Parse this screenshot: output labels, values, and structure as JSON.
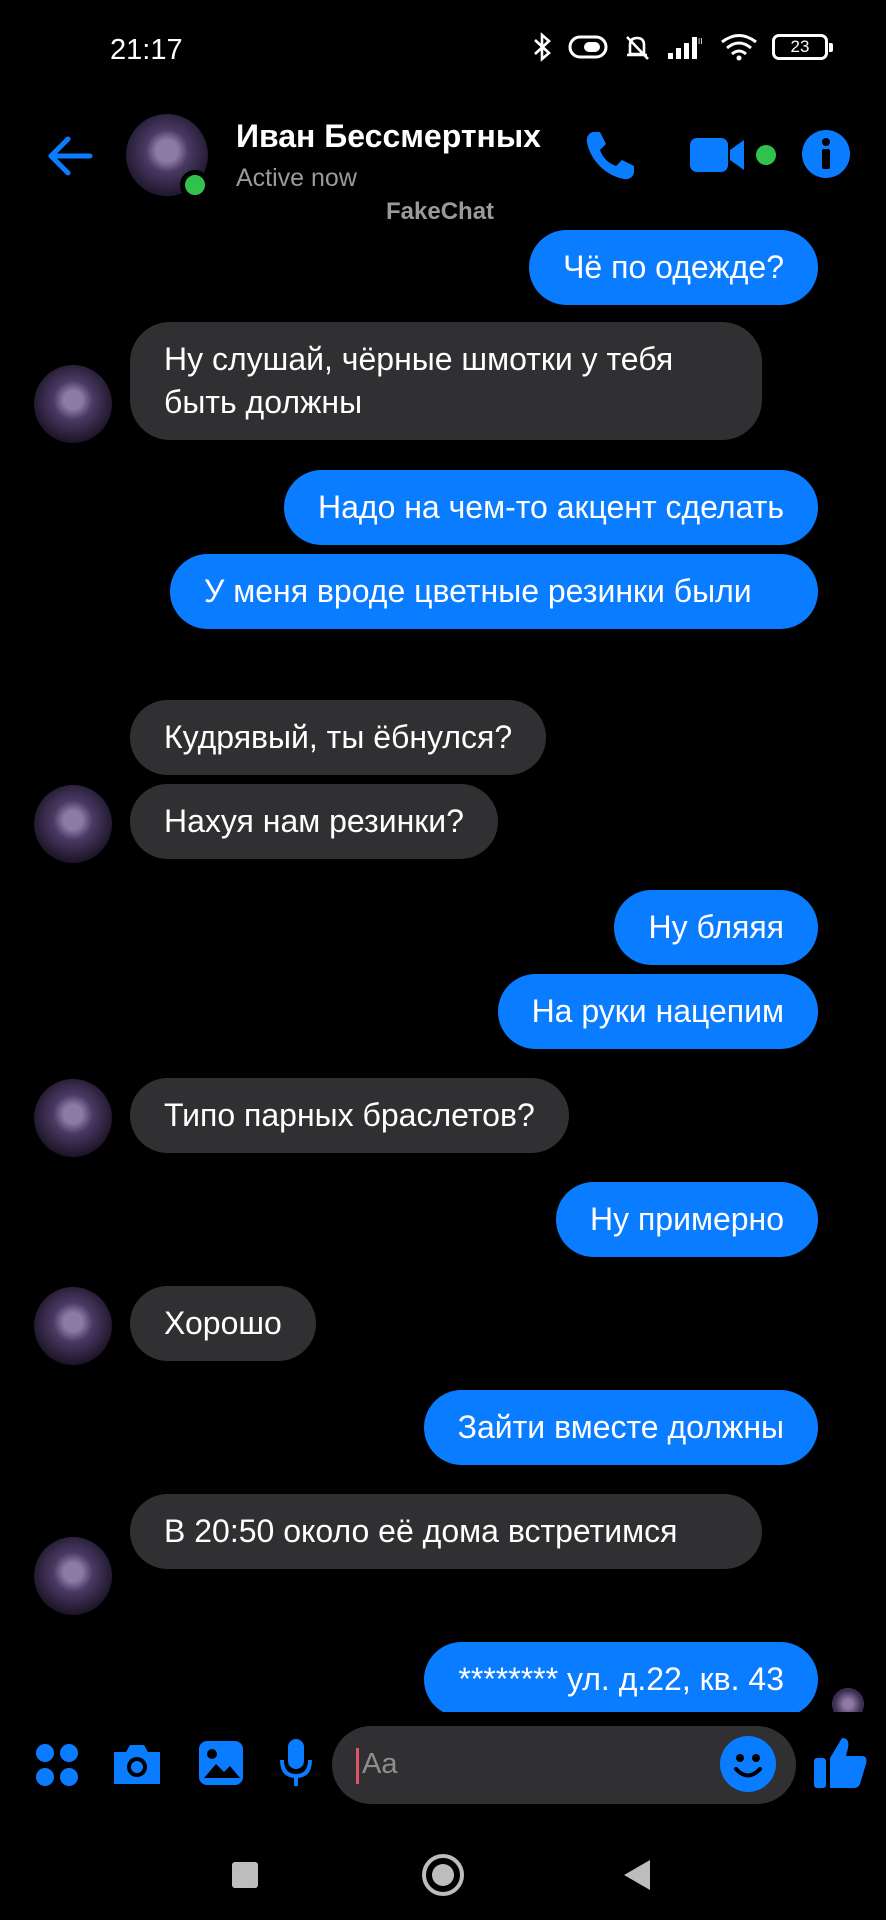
{
  "status_bar": {
    "time": "21:17",
    "battery": "23"
  },
  "header": {
    "name": "Иван Бессмертных",
    "status": "Active now",
    "watermark": "FakeChat"
  },
  "messages": [
    {
      "side": "out",
      "text": "Чё по одежде?"
    },
    {
      "side": "in",
      "text": "Ну слушай, чёрные шмотки у тебя быть должны"
    },
    {
      "side": "out",
      "text": "Надо на чем-то акцент сделать"
    },
    {
      "side": "out",
      "text": "У меня вроде цветные резинки были"
    },
    {
      "side": "in",
      "text": "Кудрявый, ты ёбнулся?"
    },
    {
      "side": "in",
      "text": "Нахуя нам резинки?"
    },
    {
      "side": "out",
      "text": "Ну бляяя"
    },
    {
      "side": "out",
      "text": "На руки нацепим"
    },
    {
      "side": "in",
      "text": "Типо парных браслетов?"
    },
    {
      "side": "out",
      "text": "Ну примерно"
    },
    {
      "side": "in",
      "text": "Хорошо"
    },
    {
      "side": "out",
      "text": "Зайти вместе должны"
    },
    {
      "side": "in",
      "text": "В 20:50 около её дома встретимся"
    },
    {
      "side": "out",
      "text": "******** ул. д.22, кв. 43"
    }
  ],
  "composer": {
    "placeholder": "Aa"
  },
  "colors": {
    "accent": "#0a7cff",
    "incoming_bubble": "#303032",
    "online": "#31c24d",
    "background": "#000000"
  }
}
